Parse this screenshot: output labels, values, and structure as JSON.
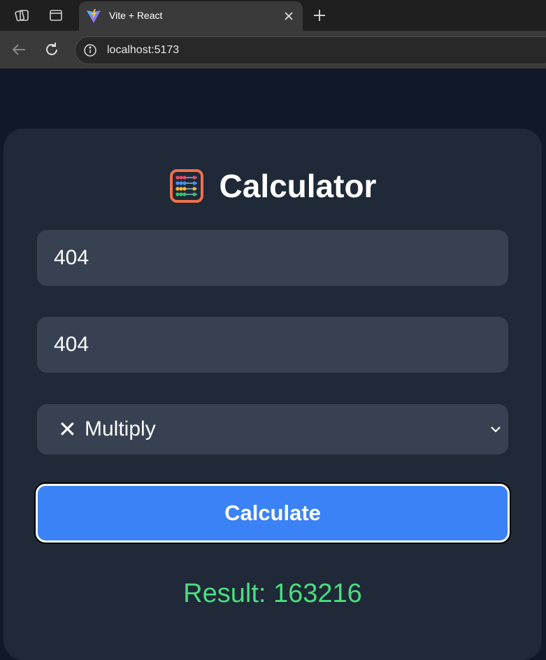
{
  "browser": {
    "tab": {
      "title": "Vite + React"
    },
    "address": {
      "url": "localhost:5173"
    }
  },
  "calculator": {
    "icon": "abacus-icon",
    "title": "Calculator",
    "first_number": "404",
    "second_number": "404",
    "operation": {
      "symbol": "✕",
      "label": "Multiply"
    },
    "button_label": "Calculate",
    "result_label": "Result:",
    "result_value": "163216"
  },
  "colors": {
    "page_background": "#111827",
    "card_background": "#1f2937",
    "input_background": "#374151",
    "button_background": "#3b82f6",
    "result_text": "#4ade80"
  }
}
